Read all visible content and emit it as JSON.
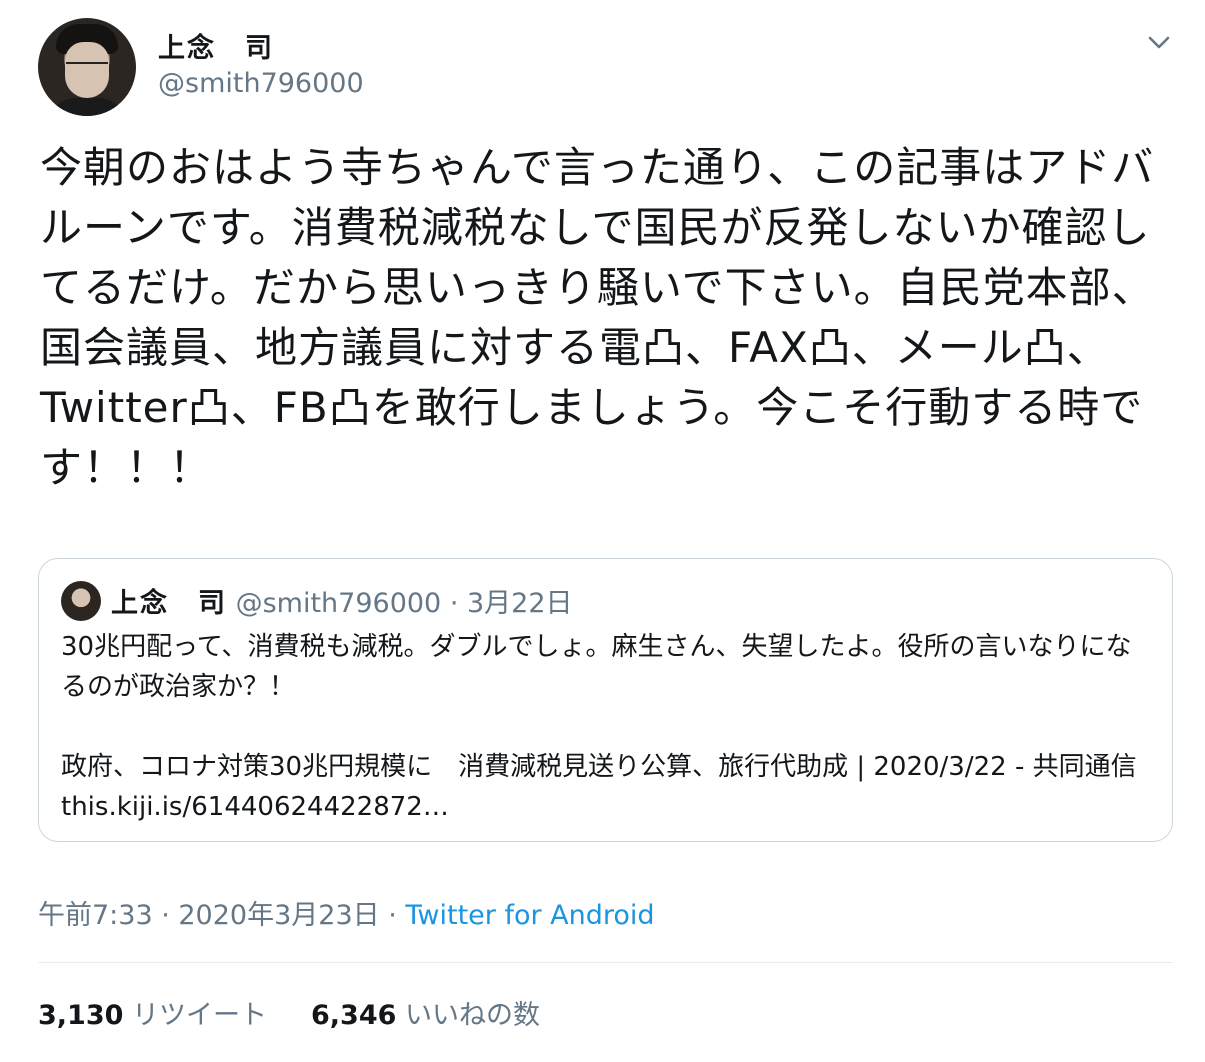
{
  "author": {
    "display_name": "上念　司",
    "handle": "@smith796000"
  },
  "menu_icon": "chevron-down-icon",
  "tweet_text": "今朝のおはよう寺ちゃんで言った通り、この記事はアドバルーンです。消費税減税なしで国民が反発しないか確認してるだけ。だから思いっきり騒いで下さい。自民党本部、国会議員、地方議員に対する電凸、FAX凸、メール凸、Twitter凸、FB凸を敢行しましょう。今こそ行動する時です！！！",
  "quoted": {
    "display_name": "上念　司",
    "handle": "@smith796000",
    "separator": " · ",
    "date": "3月22日",
    "text": "30兆円配って、消費税も減税。ダブルでしょ。麻生さん、失望したよ。役所の言いなりになるのが政治家か？！\n\n政府、コロナ対策30兆円規模に　消費減税見送り公算、旅行代助成 | 2020/3/22 - 共同通信 this.kiji.is/61440624422872…"
  },
  "timestamp": {
    "time": "午前7:33 · 2020年3月23日 · ",
    "source": "Twitter for Android"
  },
  "stats": {
    "retweets_count": "3,130",
    "retweets_label": " リツイート",
    "likes_count": "6,346",
    "likes_label": " いいねの数"
  },
  "colors": {
    "text": "#14171a",
    "secondary": "#657786",
    "link": "#1b95e0",
    "border": "#ccd6dd"
  }
}
